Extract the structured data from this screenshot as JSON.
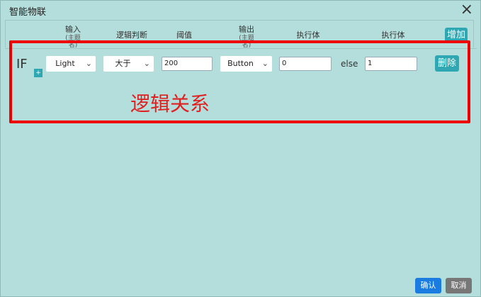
{
  "dialog": {
    "title": "智能物联",
    "close_icon": "close-icon"
  },
  "header": {
    "columns": [
      {
        "label": "输入",
        "sub": "(主题名)"
      },
      {
        "label": "逻辑判断"
      },
      {
        "label": "阈值"
      },
      {
        "label": "输出",
        "sub": "(主题名)"
      },
      {
        "label": "执行体"
      },
      {
        "label": "执行体"
      }
    ],
    "add_label": "增加"
  },
  "rule": {
    "if_label": "IF",
    "plus_label": "+",
    "input_value": "Light",
    "logic_value": "大于",
    "threshold_value": "200",
    "output_value": "Button",
    "exec_true_value": "0",
    "else_label": "else",
    "exec_false_value": "1",
    "delete_label": "删除"
  },
  "annotation": {
    "text": "逻辑关系",
    "color": "#e02020"
  },
  "footer": {
    "confirm_label": "确认",
    "cancel_label": "取消"
  },
  "colors": {
    "accent": "#2fa7b2",
    "primary": "#1a7be0",
    "background": "#b3dedb",
    "highlight": "#ee0000"
  }
}
